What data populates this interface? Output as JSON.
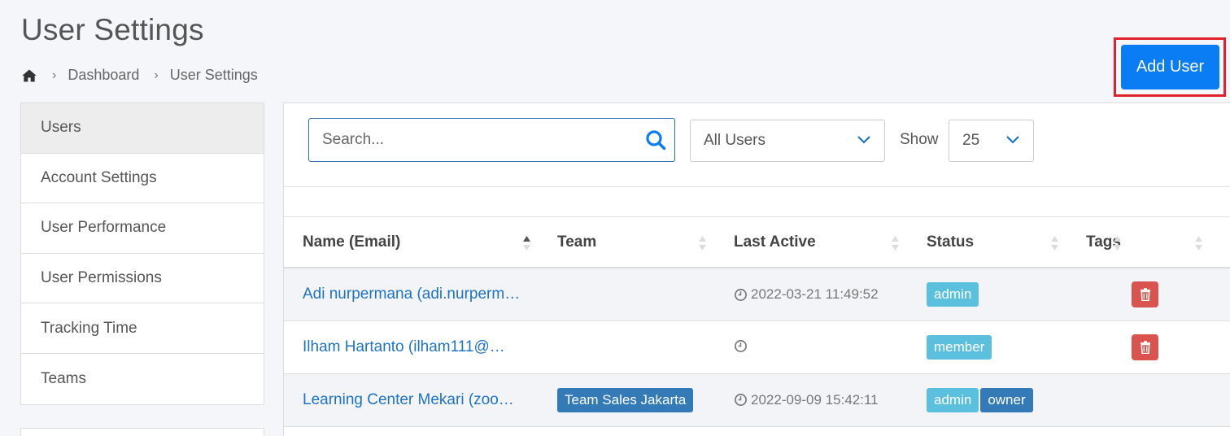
{
  "page": {
    "title": "User Settings"
  },
  "breadcrumb": {
    "items": [
      "Dashboard",
      "User Settings"
    ]
  },
  "actions": {
    "add_user": "Add User"
  },
  "sidebar": {
    "items": [
      {
        "label": "Users",
        "active": true
      },
      {
        "label": "Account Settings"
      },
      {
        "label": "User Performance"
      },
      {
        "label": "User Permissions"
      },
      {
        "label": "Tracking Time"
      },
      {
        "label": "Teams"
      }
    ]
  },
  "filters": {
    "search_placeholder": "Search...",
    "users_filter": "All Users",
    "show_label": "Show",
    "page_size": "25"
  },
  "table": {
    "columns": [
      "Name (Email)",
      "Team",
      "Last Active",
      "Status",
      "Tags"
    ],
    "rows": [
      {
        "name": "Adi nurpermana (adi.nurpermana@…",
        "team": "",
        "last_active": "2022-03-21 11:49:52",
        "status": [
          "admin"
        ],
        "deletable": true
      },
      {
        "name": "Ilham Hartanto (ilham111@…",
        "team": "",
        "last_active": "",
        "status": [
          "member"
        ],
        "deletable": true
      },
      {
        "name": "Learning Center Mekari (zoo…",
        "team": "Team Sales Jakarta",
        "last_active": "2022-09-09 15:42:11",
        "status": [
          "admin",
          "owner"
        ],
        "deletable": false
      }
    ]
  },
  "colors": {
    "primary": "#0a7cf4",
    "highlight": "#e0202a",
    "link": "#1f73c5",
    "badge_info": "#5bc0de",
    "badge_primary": "#337ab7",
    "danger": "#d9534f"
  }
}
